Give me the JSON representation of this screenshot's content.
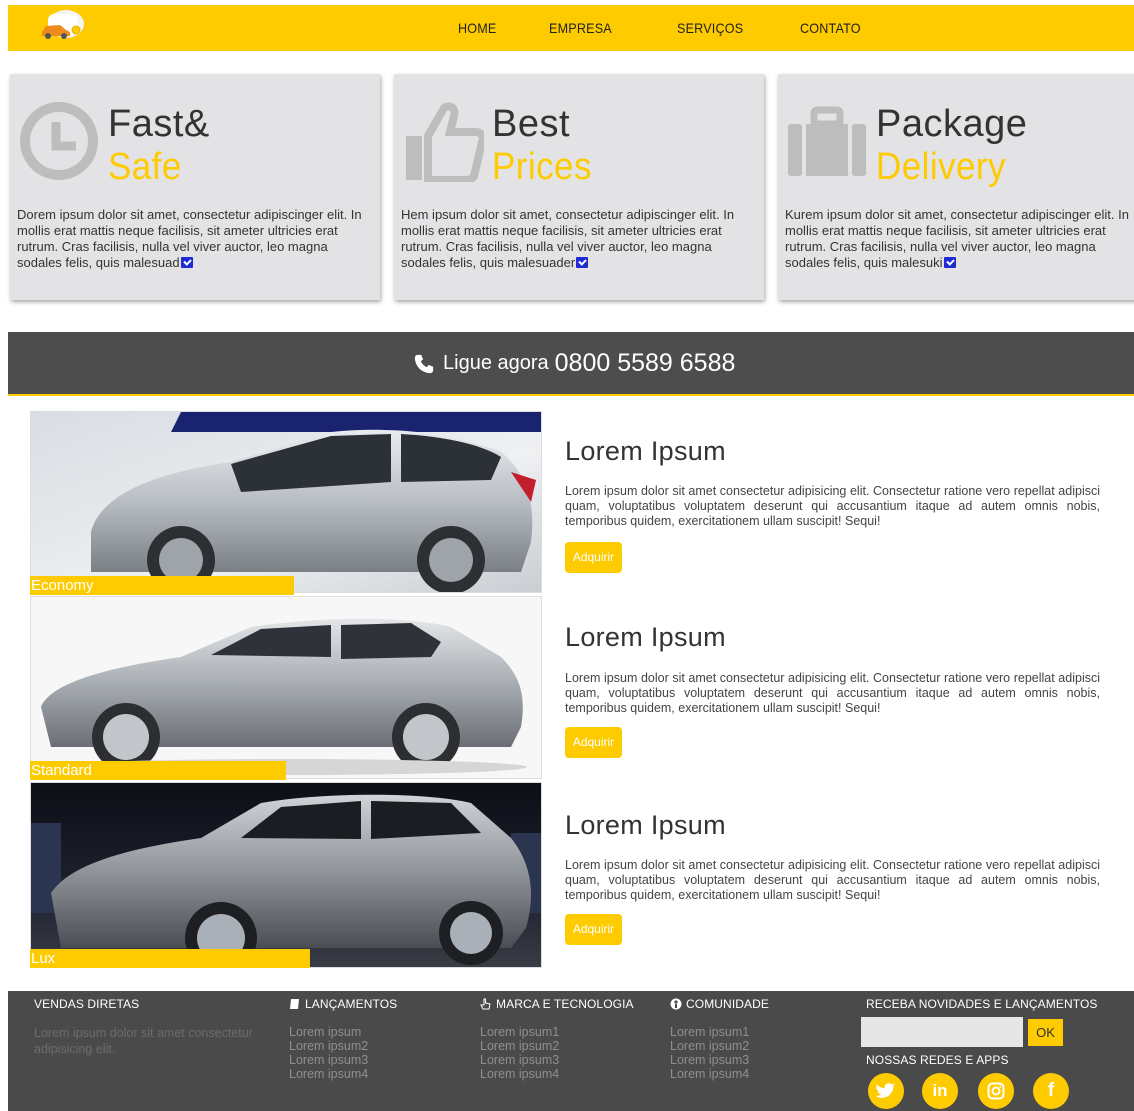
{
  "nav": {
    "items": [
      "HOME",
      "EMPRESA",
      "SERVIÇOS",
      "CONTATO"
    ]
  },
  "features": [
    {
      "title1": "Fast&",
      "title2": "Safe",
      "icon": "clock-icon",
      "desc": "Dorem ipsum dolor sit amet, consectetur adipiscinger elit. In mollis erat mattis neque facilisis, sit ameter ultricies erat rutrum. Cras facilisis, nulla vel viver auctor, leo magna sodales felis, quis malesuad"
    },
    {
      "title1": "Best",
      "title2": "Prices",
      "icon": "thumbs-up-icon",
      "desc": "Hem ipsum dolor sit amet, consectetur adipiscinger elit. In mollis erat mattis neque facilisis, sit ameter ultricies erat rutrum. Cras facilisis, nulla vel viver auctor, leo magna sodales felis, quis malesuader"
    },
    {
      "title1": "Package",
      "title2": "Delivery",
      "icon": "briefcase-icon",
      "desc": "Kurem ipsum dolor sit amet, consectetur adipiscinger elit. In mollis erat mattis neque facilisis, sit ameter ultricies erat rutrum. Cras facilisis, nulla vel viver auctor, leo magna sodales felis, quis malesuki"
    }
  ],
  "callbar": {
    "label": "Ligue agora",
    "number": "0800 5589 6588"
  },
  "cars": [
    {
      "tag": "Economy",
      "title": "Lorem Ipsum",
      "desc": "Lorem ipsum dolor sit amet consectetur adipisicing elit. Consectetur ratione vero repellat adipisci quam, voluptatibus voluptatem deserunt qui accusantium itaque ad autem omnis nobis, temporibus quidem, exercitationem ullam suscipit! Sequi!",
      "button": "Adquirir"
    },
    {
      "tag": "Standard",
      "title": "Lorem Ipsum",
      "desc": "Lorem ipsum dolor sit amet consectetur adipisicing elit. Consectetur ratione vero repellat adipisci quam, voluptatibus voluptatem deserunt qui accusantium itaque ad autem omnis nobis, temporibus quidem, exercitationem ullam suscipit! Sequi!",
      "button": "Adquirir"
    },
    {
      "tag": "Lux",
      "title": "Lorem Ipsum",
      "desc": "Lorem ipsum dolor sit amet consectetur adipisicing elit. Consectetur ratione vero repellat adipisci quam, voluptatibus voluptatem deserunt qui accusantium itaque ad autem omnis nobis, temporibus quidem, exercitationem ullam suscipit! Sequi!",
      "button": "Adquirir"
    }
  ],
  "footer": {
    "vendas": {
      "heading": "VENDAS DIRETAS",
      "text": "Lorem ipsum dolor sit amet consectetur adipisicing elit."
    },
    "lancamentos": {
      "heading": "LANÇAMENTOS",
      "items": [
        "Lorem ipsum",
        "Lorem ipsum2",
        "Lorem ipsum3",
        "Lorem ipsum4"
      ]
    },
    "marca": {
      "heading": "MARCA E TECNOLOGIA",
      "items": [
        "Lorem ipsum1",
        "Lorem ipsum2",
        "Lorem ipsum3",
        "Lorem ipsum4"
      ]
    },
    "comunidade": {
      "heading": "COMUNIDADE",
      "items": [
        "Lorem ipsum1",
        "Lorem ipsum2",
        "Lorem ipsum3",
        "Lorem ipsum4"
      ]
    },
    "newsletter": {
      "heading": "RECEBA NOVIDADES E LANÇAMENTOS",
      "input_value": "",
      "ok_label": "OK",
      "social_heading": "NOSSAS REDES E APPS"
    },
    "social": [
      {
        "name": "twitter-icon",
        "glyph": "🐦"
      },
      {
        "name": "linkedin-icon",
        "glyph": "in"
      },
      {
        "name": "instagram-icon",
        "glyph": "◎"
      },
      {
        "name": "facebook-icon",
        "glyph": "f"
      }
    ]
  },
  "colors": {
    "accent": "#fecb00",
    "dark": "#4d4d4d",
    "card_bg": "#e3e3e6"
  }
}
